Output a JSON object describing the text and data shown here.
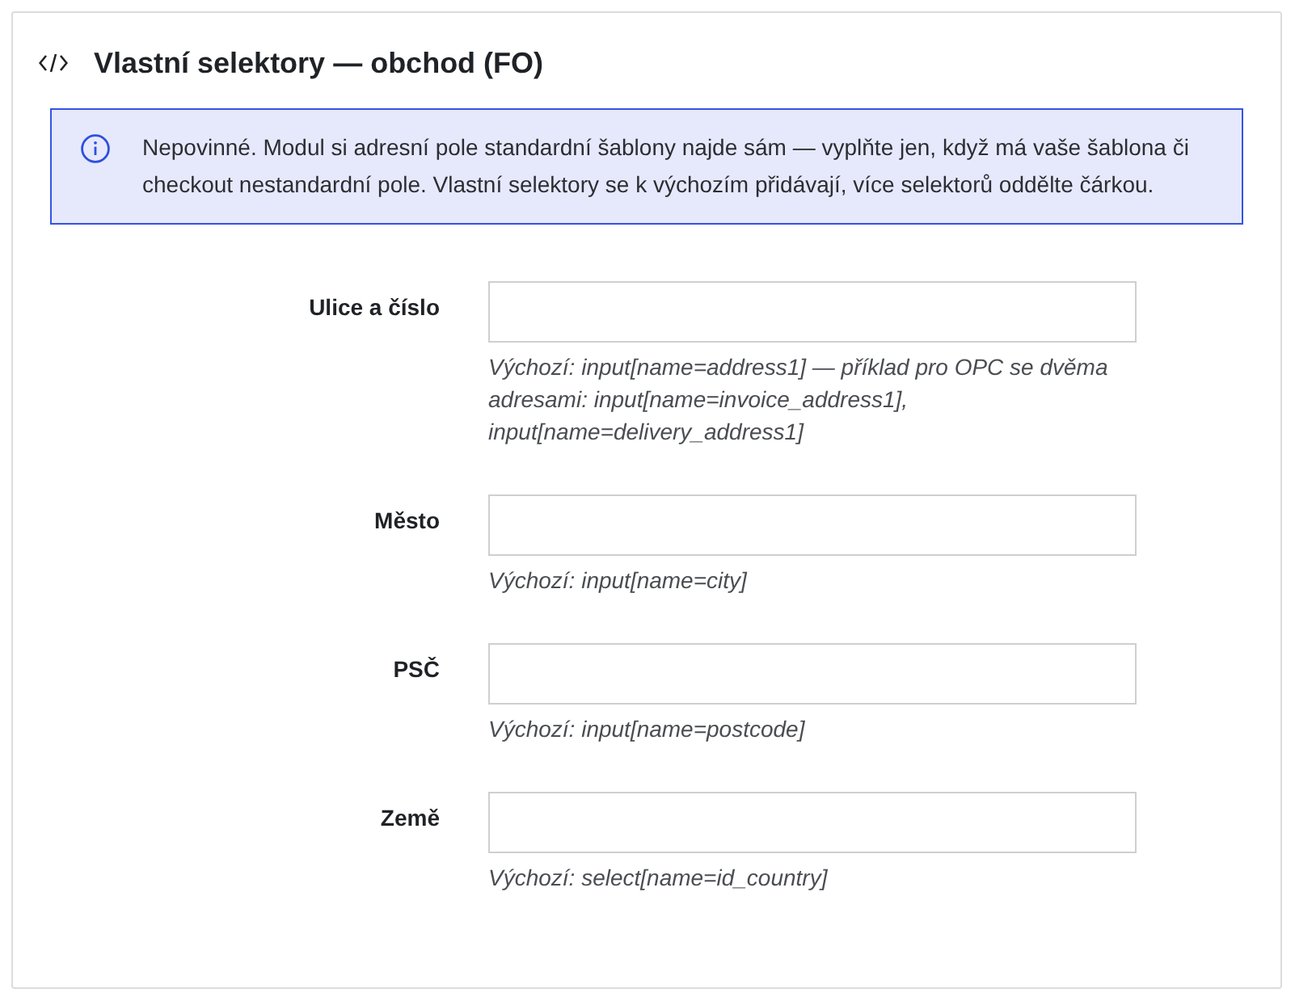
{
  "panel": {
    "title": "Vlastní selektory — obchod (FO)"
  },
  "alert": {
    "text": "Nepovinné. Modul si adresní pole standardní šablony najde sám — vyplňte jen, když má vaše šablona či checkout nestandardní pole. Vlastní selektory se k výchozím přidávají, více selektorů oddělte čárkou."
  },
  "fields": [
    {
      "label": "Ulice a číslo",
      "help": "Výchozí: input[name=address1] — příklad pro OPC se dvěma adresami: input[name=invoice_address1], input[name=delivery_address1]"
    },
    {
      "label": "Město",
      "help": "Výchozí: input[name=city]"
    },
    {
      "label": "PSČ",
      "help": "Výchozí: input[name=postcode]"
    },
    {
      "label": "Země",
      "help": "Výchozí: select[name=id_country]"
    }
  ]
}
